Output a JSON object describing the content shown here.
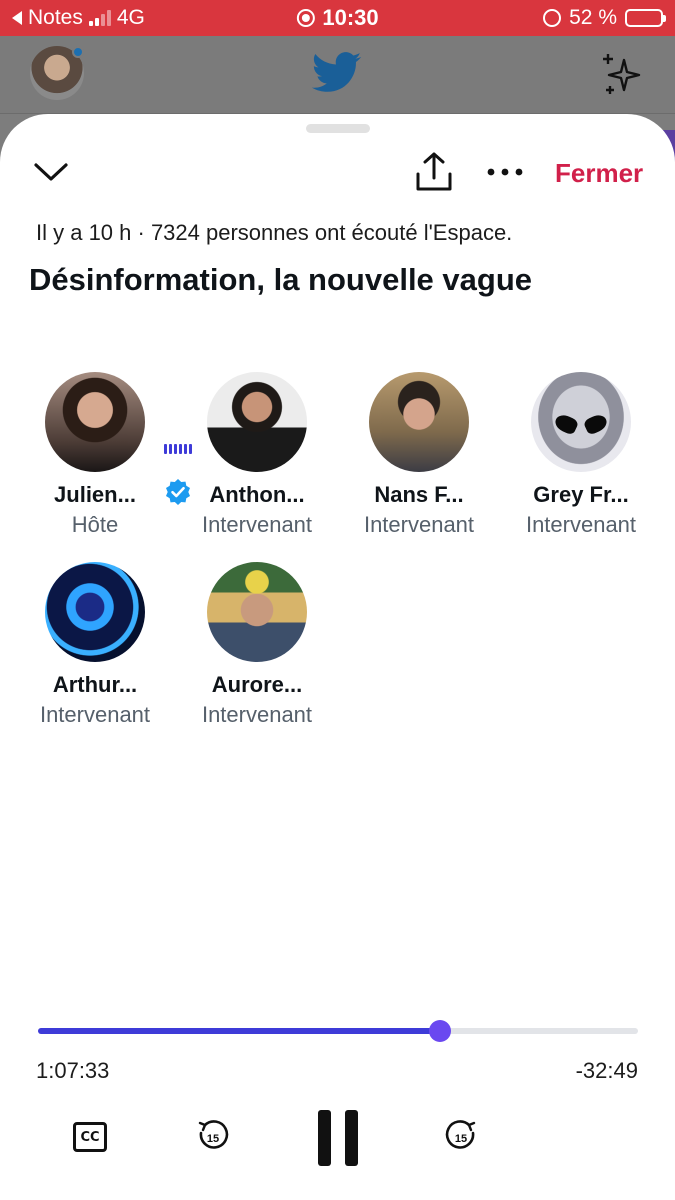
{
  "status_bar": {
    "back_app": "Notes",
    "network": "4G",
    "time": "10:30",
    "battery": "52 %",
    "battery_level": 0.52,
    "background_color": "#d9363e"
  },
  "header": {
    "close_label": "Fermer",
    "accent_color": "#d1204a"
  },
  "space": {
    "meta": "Il y a 10 h · 7324 personnes ont écouté l'Espace.",
    "title": "Désinformation, la nouvelle vague"
  },
  "participants": [
    {
      "name": "Julien...",
      "role": "Hôte",
      "verified": true
    },
    {
      "name": "Anthon...",
      "role": "Intervenant"
    },
    {
      "name": "Nans F...",
      "role": "Intervenant"
    },
    {
      "name": "Grey Fr...",
      "role": "Intervenant"
    },
    {
      "name": "Arthur...",
      "role": "Intervenant",
      "speaking": true
    },
    {
      "name": "Aurore...",
      "role": "Intervenant"
    }
  ],
  "player": {
    "elapsed": "1:07:33",
    "remaining": "-32:49",
    "progress": 0.67,
    "progress_color": "#3e3bd8",
    "cc_label": "CC",
    "skip_back_seconds": "15",
    "skip_forward_seconds": "15"
  },
  "icons": [
    "chevron-down-icon",
    "share-icon",
    "more-icon",
    "twitter-bird-icon",
    "sparkle-icon",
    "verified-icon",
    "pause-icon",
    "rewind-15-icon",
    "forward-15-icon",
    "captions-icon"
  ]
}
